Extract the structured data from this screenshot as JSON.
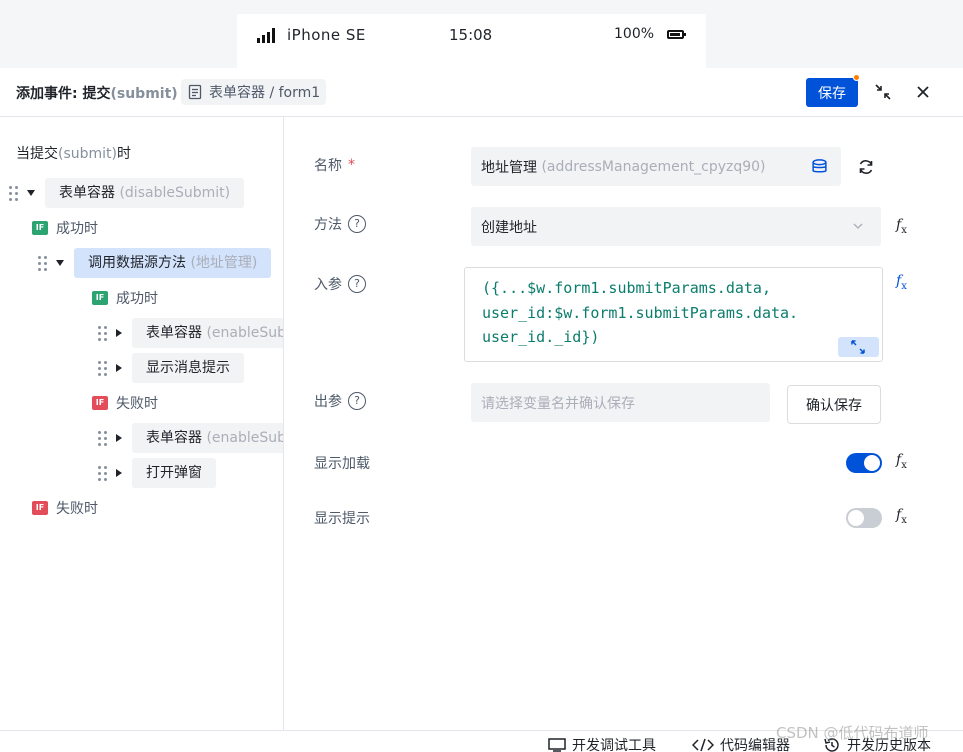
{
  "phone": {
    "device": "iPhone SE",
    "time": "15:08",
    "battery": "100%"
  },
  "header": {
    "title_prefix": "添加事件: 提交",
    "title_event": "(submit)",
    "breadcrumb": "表单容器 / form1",
    "save_label": "保存"
  },
  "tree": {
    "head_prefix": "当提交",
    "head_event": "(submit)",
    "head_suffix": "时",
    "items": [
      {
        "label": "表单容器",
        "sub": "(disableSubmit)"
      },
      {
        "label": "成功时"
      },
      {
        "label": "调用数据源方法",
        "sub": "(地址管理)"
      },
      {
        "label": "成功时"
      },
      {
        "label": "表单容器",
        "sub": "(enableSubmit)"
      },
      {
        "label": "显示消息提示"
      },
      {
        "label": "失败时"
      },
      {
        "label": "表单容器",
        "sub": "(enableSubmit)"
      },
      {
        "label": "打开弹窗"
      },
      {
        "label": "失败时"
      }
    ],
    "if_tag": "IF"
  },
  "form": {
    "name_label": "名称",
    "name_required": "*",
    "name_value": "地址管理",
    "name_sub": "(addressManagement_cpyzq90)",
    "method_label": "方法",
    "method_value": "创建地址",
    "params_label": "入参",
    "params_code_line1": "({...$w.form1.submitParams.data,",
    "params_code_line2": "user_id:$w.form1.submitParams.data.",
    "params_code_line3": "user_id._id})",
    "output_label": "出参",
    "output_placeholder": "请选择变量名并确认保存",
    "confirm_label": "确认保存",
    "show_loading_label": "显示加载",
    "show_loading_on": true,
    "show_tip_label": "显示提示",
    "show_tip_on": false,
    "help_mark": "?",
    "fx_label": "f"
  },
  "bottom": {
    "debug_tools": "开发调试工具",
    "code_editor": "代码编辑器",
    "history": "开发历史版本"
  },
  "watermark": "CSDN @低代码布道师",
  "colors": {
    "primary": "#0052d9",
    "success_tag": "#2ba471",
    "fail_tag": "#e34d59",
    "code": "#0b7d6c"
  }
}
